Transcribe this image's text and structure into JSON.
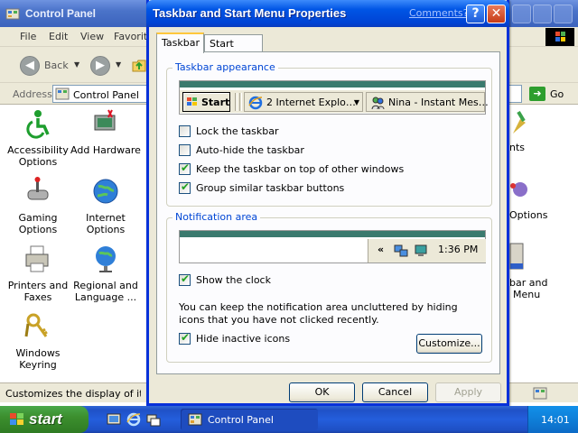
{
  "control_panel": {
    "title": "Control Panel",
    "menu": [
      "File",
      "Edit",
      "View",
      "Favorit"
    ],
    "toolbar": {
      "back_label": "Back"
    },
    "address": {
      "label": "Address",
      "value": "Control Panel",
      "go_label": "Go"
    },
    "items": [
      {
        "label": "Accessibility Options",
        "icon": "accessibility-icon"
      },
      {
        "label": "Add Hardware",
        "icon": "add-hardware-icon"
      },
      {
        "label": "Gaming Options",
        "icon": "gamepad-icon"
      },
      {
        "label": "Internet Options",
        "icon": "globe-icon"
      },
      {
        "label": "Printers and Faxes",
        "icon": "printer-icon"
      },
      {
        "label": "Regional and Language ...",
        "icon": "regional-globe-icon"
      },
      {
        "label": "Windows Keyring",
        "icon": "keyring-icon"
      }
    ],
    "partial_items": [
      "nts",
      "Options",
      "bar and",
      "Menu"
    ],
    "status": "Customizes the display of items i"
  },
  "dialog": {
    "title": "Taskbar and Start Menu Properties",
    "comments_link": "Comments?",
    "help_button": "?",
    "close_button": "✕",
    "tabs": [
      "Taskbar",
      "Start Menu"
    ],
    "appearance": {
      "legend": "Taskbar appearance",
      "preview": {
        "start_label": "Start",
        "items": [
          {
            "label": "2 Internet Explo…",
            "icon": "internet-explorer-icon"
          },
          {
            "label": "Nina - Instant Mes…",
            "icon": "messenger-icon"
          }
        ]
      },
      "options": [
        {
          "label": "Lock the taskbar",
          "checked": false
        },
        {
          "label": "Auto-hide the taskbar",
          "checked": false
        },
        {
          "label": "Keep the taskbar on top of other windows",
          "checked": true
        },
        {
          "label": "Group similar taskbar buttons",
          "checked": true
        }
      ]
    },
    "notification": {
      "legend": "Notification area",
      "tray_chevron": "«",
      "tray_time": "1:36 PM",
      "show_clock_label": "Show the clock",
      "show_clock_checked": true,
      "description": "You can keep the notification area uncluttered by hiding icons that you have not clicked recently.",
      "hide_inactive_label": "Hide inactive icons",
      "hide_inactive_checked": true,
      "customize_button": "Customize..."
    },
    "buttons": {
      "ok": "OK",
      "cancel": "Cancel",
      "apply": "Apply"
    }
  },
  "taskbar": {
    "start_label": "start",
    "task_label": "Control Panel",
    "clock": "14:01"
  }
}
